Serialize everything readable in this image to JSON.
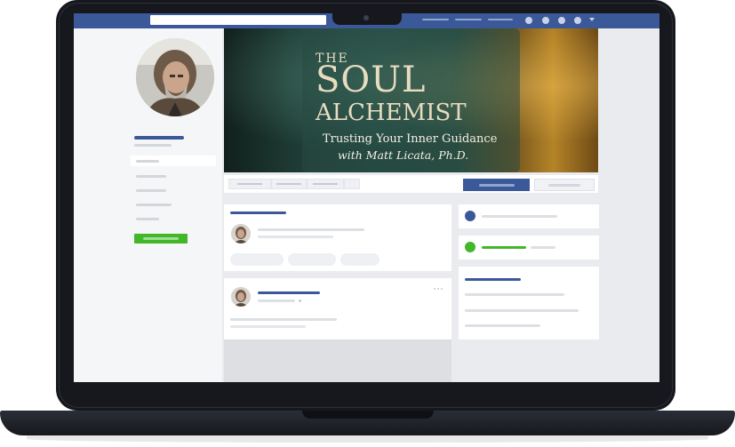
{
  "cover": {
    "line_the": "THE",
    "line_soul": "SOUL",
    "line_alchemist": "ALCHEMIST",
    "subtitle": "Trusting Your Inner Guidance",
    "byline": "with Matt Licata, Ph.D."
  },
  "colors": {
    "facebook_blue": "#3b5998",
    "accent_green": "#42b72a",
    "background": "#e9ebee"
  },
  "icons": [
    "friends-icon",
    "messages-icon",
    "notifications-icon",
    "help-icon",
    "dropdown-icon"
  ]
}
